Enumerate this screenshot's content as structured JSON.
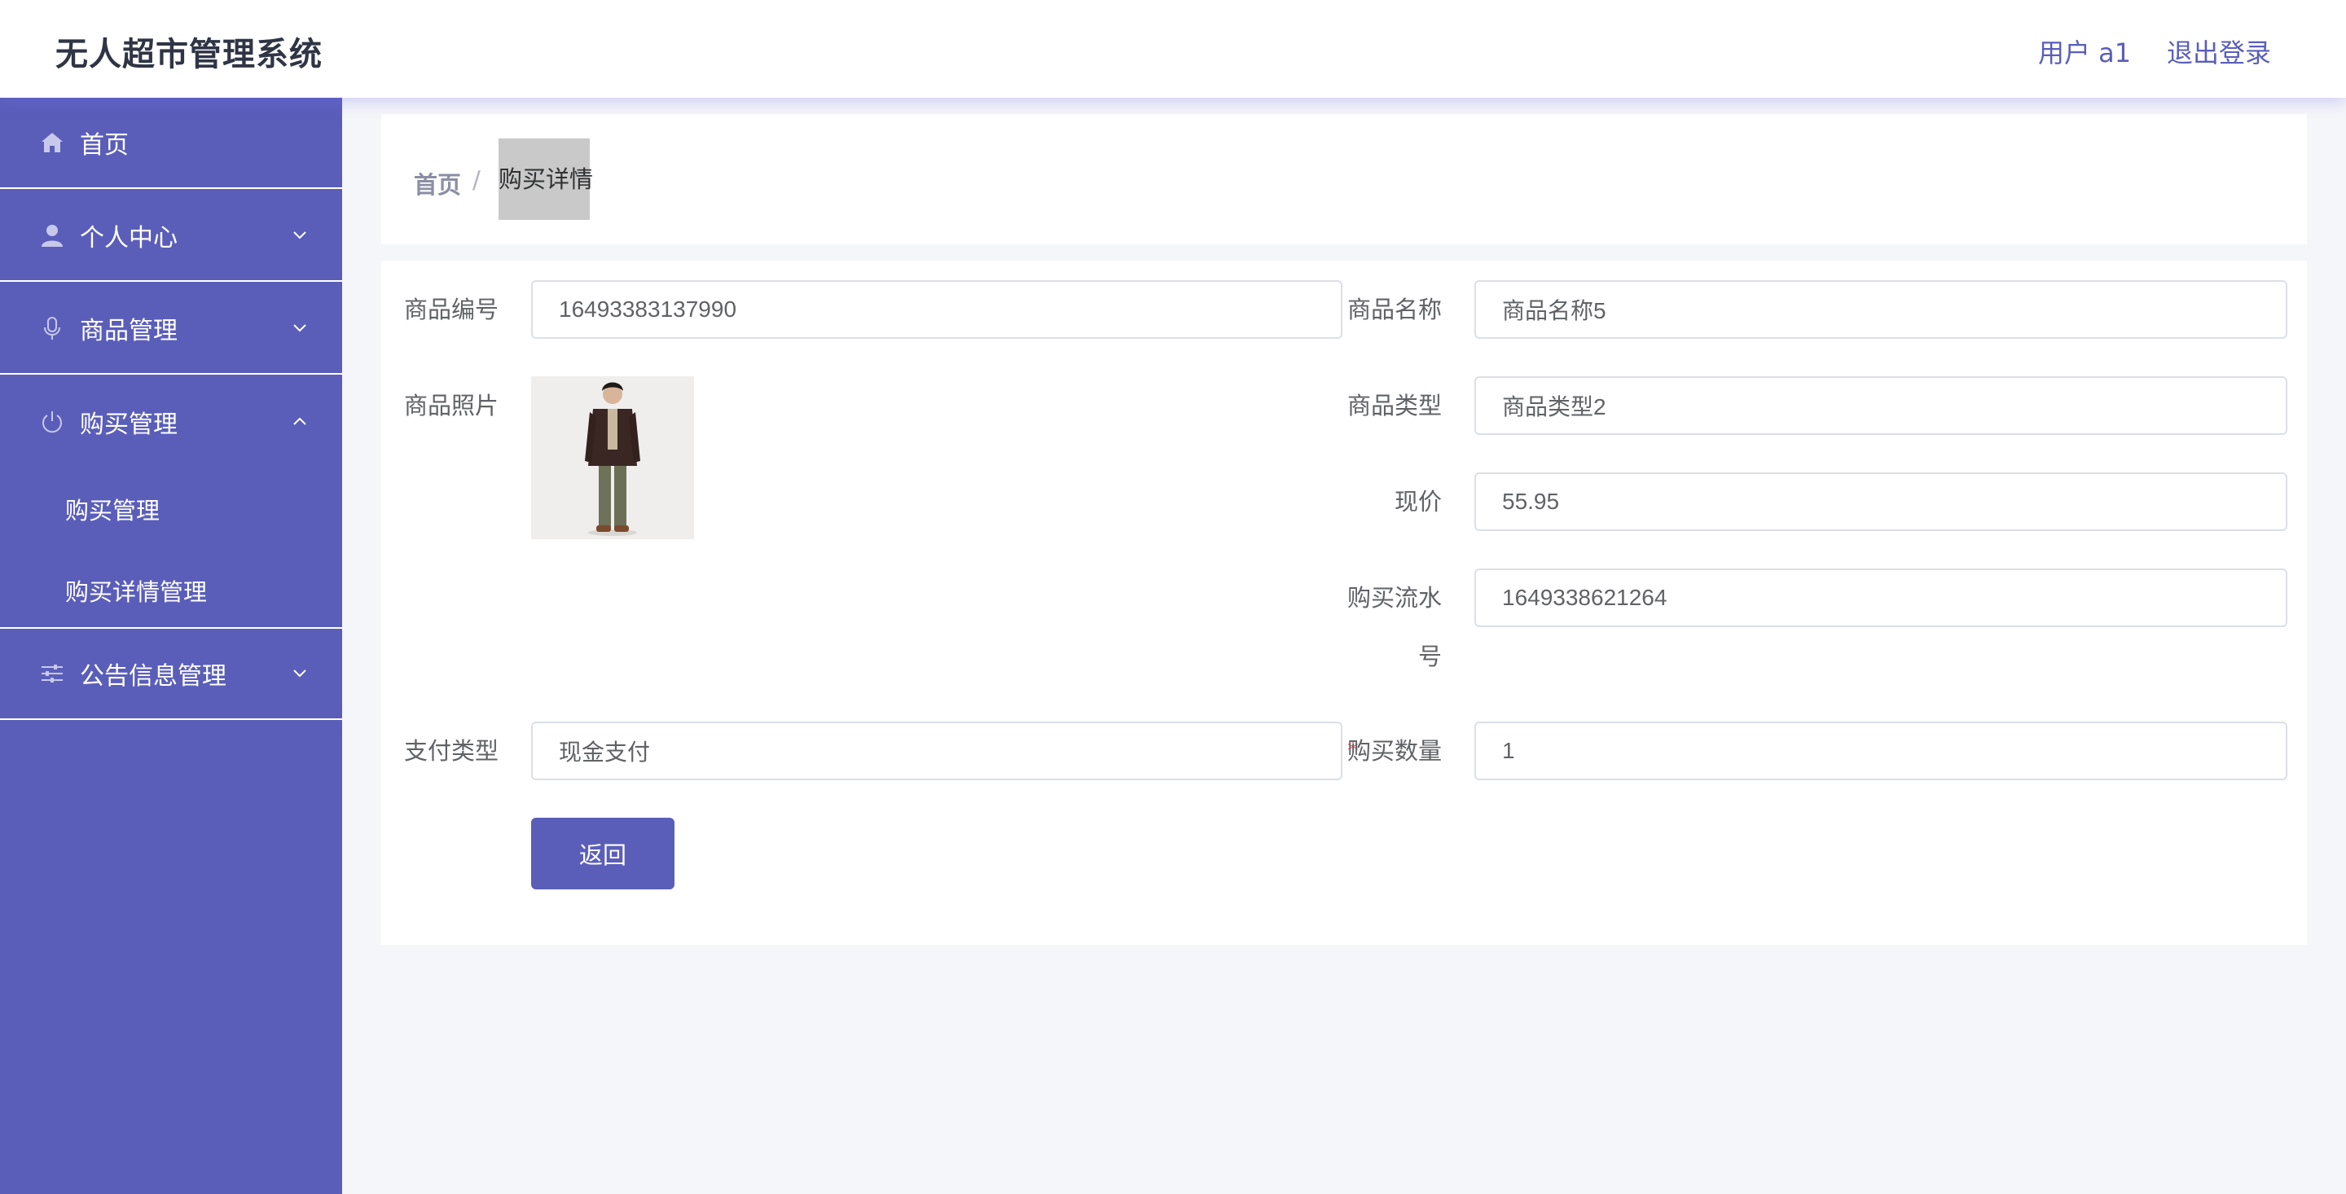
{
  "header": {
    "app_title": "无人超市管理系统",
    "user_label": "用户 a1",
    "logout_label": "退出登录"
  },
  "sidebar": {
    "items": [
      {
        "label": "首页",
        "icon": "home-icon"
      },
      {
        "label": "个人中心",
        "icon": "user-icon"
      },
      {
        "label": "商品管理",
        "icon": "microphone-icon"
      },
      {
        "label": "购买管理",
        "icon": "power-icon"
      },
      {
        "label": "公告信息管理",
        "icon": "sliders-icon"
      }
    ],
    "subitems": [
      {
        "label": "购买管理"
      },
      {
        "label": "购买详情管理"
      }
    ]
  },
  "breadcrumb": {
    "home": "首页",
    "separator": "/",
    "current": "购买详情"
  },
  "form": {
    "product_code": {
      "label": "商品编号",
      "value": "16493383137990"
    },
    "product_name": {
      "label": "商品名称",
      "value": "商品名称5"
    },
    "product_photo": {
      "label": "商品照片"
    },
    "product_type": {
      "label": "商品类型",
      "value": "商品类型2"
    },
    "price": {
      "label": "现价",
      "value": "55.95"
    },
    "serial": {
      "label_line1": "购买流水",
      "label_line2": "号",
      "value": "1649338621264"
    },
    "pay_type": {
      "label": "支付类型",
      "value": "现金支付"
    },
    "quantity": {
      "label": "购买数量",
      "value": "1",
      "required_mark": "*"
    },
    "back_button": "返回"
  },
  "colors": {
    "brand": "#5a5eb9",
    "background": "#f5f6f9",
    "required": "#f56c6c"
  }
}
